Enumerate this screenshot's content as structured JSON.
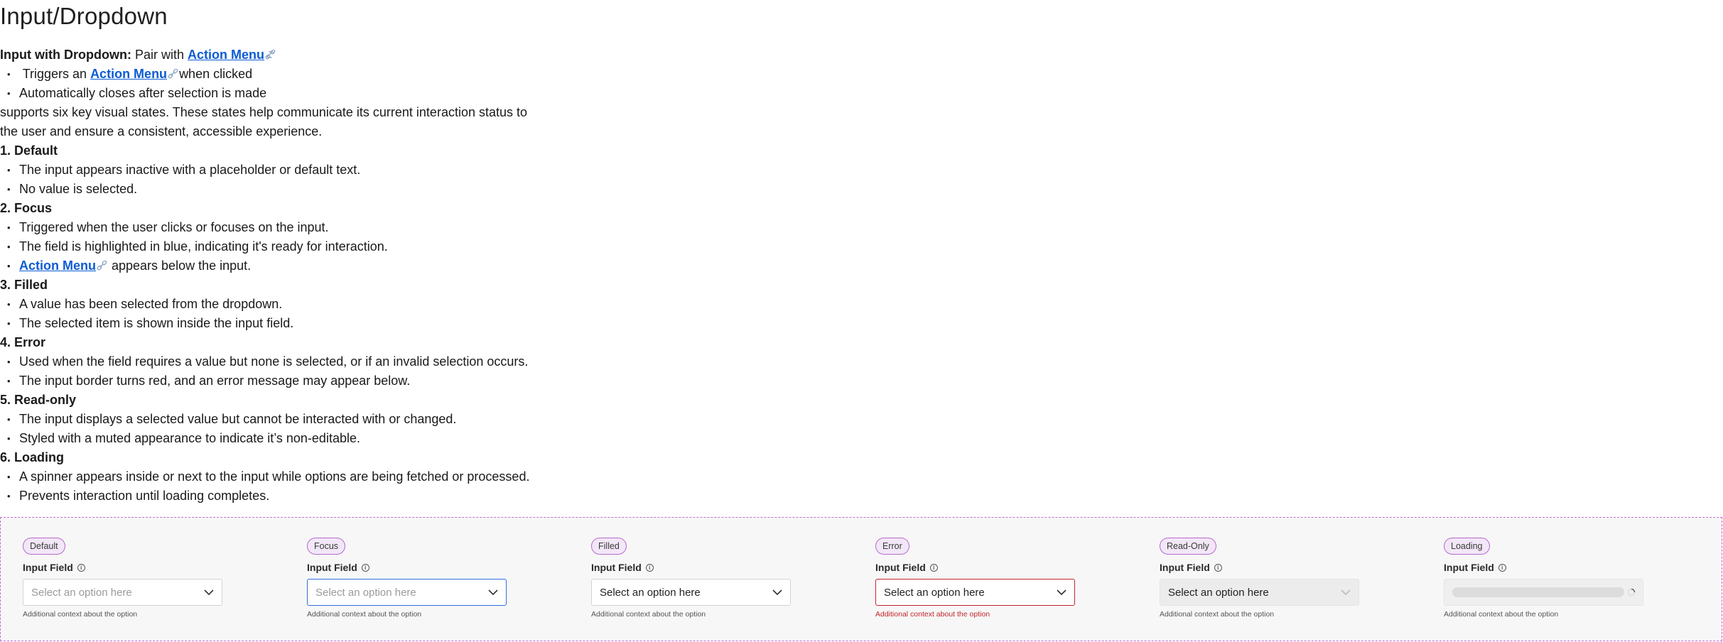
{
  "page_title": "Input/Dropdown",
  "intro": {
    "lead_bold": "Input with Dropdown:",
    "lead_text": " Pair with ",
    "link_label": "Action Menu"
  },
  "bullets_top": [
    {
      "pre": "Triggers an ",
      "link": "Action Menu",
      "post": "when clicked"
    },
    {
      "text": "Automatically closes after selection is made"
    }
  ],
  "summary_lines": [
    "supports six key visual states. These states help communicate its current interaction status to",
    "the user and ensure a consistent, accessible experience."
  ],
  "sections": [
    {
      "heading": "1. Default",
      "items": [
        "The input appears inactive with a placeholder or default text.",
        "No value is selected."
      ]
    },
    {
      "heading": "2. Focus",
      "items": [
        "Triggered when the user clicks or focuses on the input.",
        "The field is highlighted in blue, indicating it's ready for interaction."
      ],
      "link_item": {
        "link": "Action Menu",
        "post": " appears below the input."
      }
    },
    {
      "heading": "3. Filled",
      "items": [
        "A value has been selected from the dropdown.",
        "The selected item is shown inside the input field."
      ]
    },
    {
      "heading": "4. Error",
      "items": [
        "Used when the field requires a value but none is selected, or if an invalid selection occurs.",
        "The input border turns red, and an error message may appear below."
      ]
    },
    {
      "heading": "5. Read-only",
      "items": [
        "The input displays a selected value but cannot be interacted with or changed.",
        "Styled with a muted appearance to indicate it’s non-editable."
      ]
    },
    {
      "heading": "6. Loading",
      "items": [
        "A spinner appears inside or next to the input while options are being fetched or processed.",
        "Prevents interaction until loading completes."
      ]
    }
  ],
  "states": [
    {
      "badge": "Default",
      "label": "Input Field",
      "value": "Select an option here",
      "helper": "Additional context about the option"
    },
    {
      "badge": "Focus",
      "label": "Input Field",
      "value": "Select an option here",
      "helper": "Additional context about the option"
    },
    {
      "badge": "Filled",
      "label": "Input Field",
      "value": "Select an option here",
      "helper": "Additional context about the option"
    },
    {
      "badge": "Error",
      "label": "Input Field",
      "value": "Select an option here",
      "helper": "Additional context about the option"
    },
    {
      "badge": "Read-Only",
      "label": "Input Field",
      "value": "Select an option here",
      "helper": "Additional context about the option"
    },
    {
      "badge": "Loading",
      "label": "Input Field",
      "helper": "Additional context about the option"
    }
  ],
  "colors": {
    "link": "#0b5bd3",
    "focus": "#2e6fe0",
    "error": "#c1262b",
    "badge_border": "#b86ad0",
    "dashed_border": "#c36bd4"
  },
  "icons": {
    "link": "link-icon",
    "info": "info-icon",
    "chevron": "chevron-down-icon",
    "spinner": "spinner-icon"
  }
}
